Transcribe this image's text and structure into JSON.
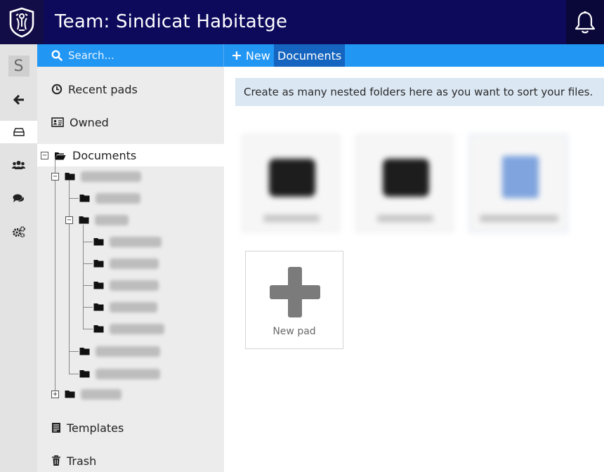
{
  "header": {
    "title": "Team: Sindicat Habitatge",
    "logo_icon": "shield-logo-icon",
    "bell_icon": "bell-icon",
    "background": "#0d0a5c"
  },
  "rail": {
    "avatar_letter": "S",
    "items": [
      {
        "name": "back",
        "icon": "arrow-left-icon"
      },
      {
        "name": "drive",
        "icon": "drive-icon",
        "active": true
      },
      {
        "name": "members",
        "icon": "users-icon"
      },
      {
        "name": "chat",
        "icon": "chat-icon"
      },
      {
        "name": "admin",
        "icon": "gears-icon"
      }
    ]
  },
  "toolbar": {
    "search_placeholder": "Search...",
    "new_label": "New",
    "breadcrumb": "Documents",
    "accent": "#2196f3"
  },
  "sidebar": {
    "recent_label": "Recent pads",
    "owned_label": "Owned",
    "documents_label": "Documents",
    "templates_label": "Templates",
    "trash_label": "Trash"
  },
  "main": {
    "info_text": "Create as many nested folders here as you want to sort your files.",
    "new_pad_label": "New pad"
  }
}
